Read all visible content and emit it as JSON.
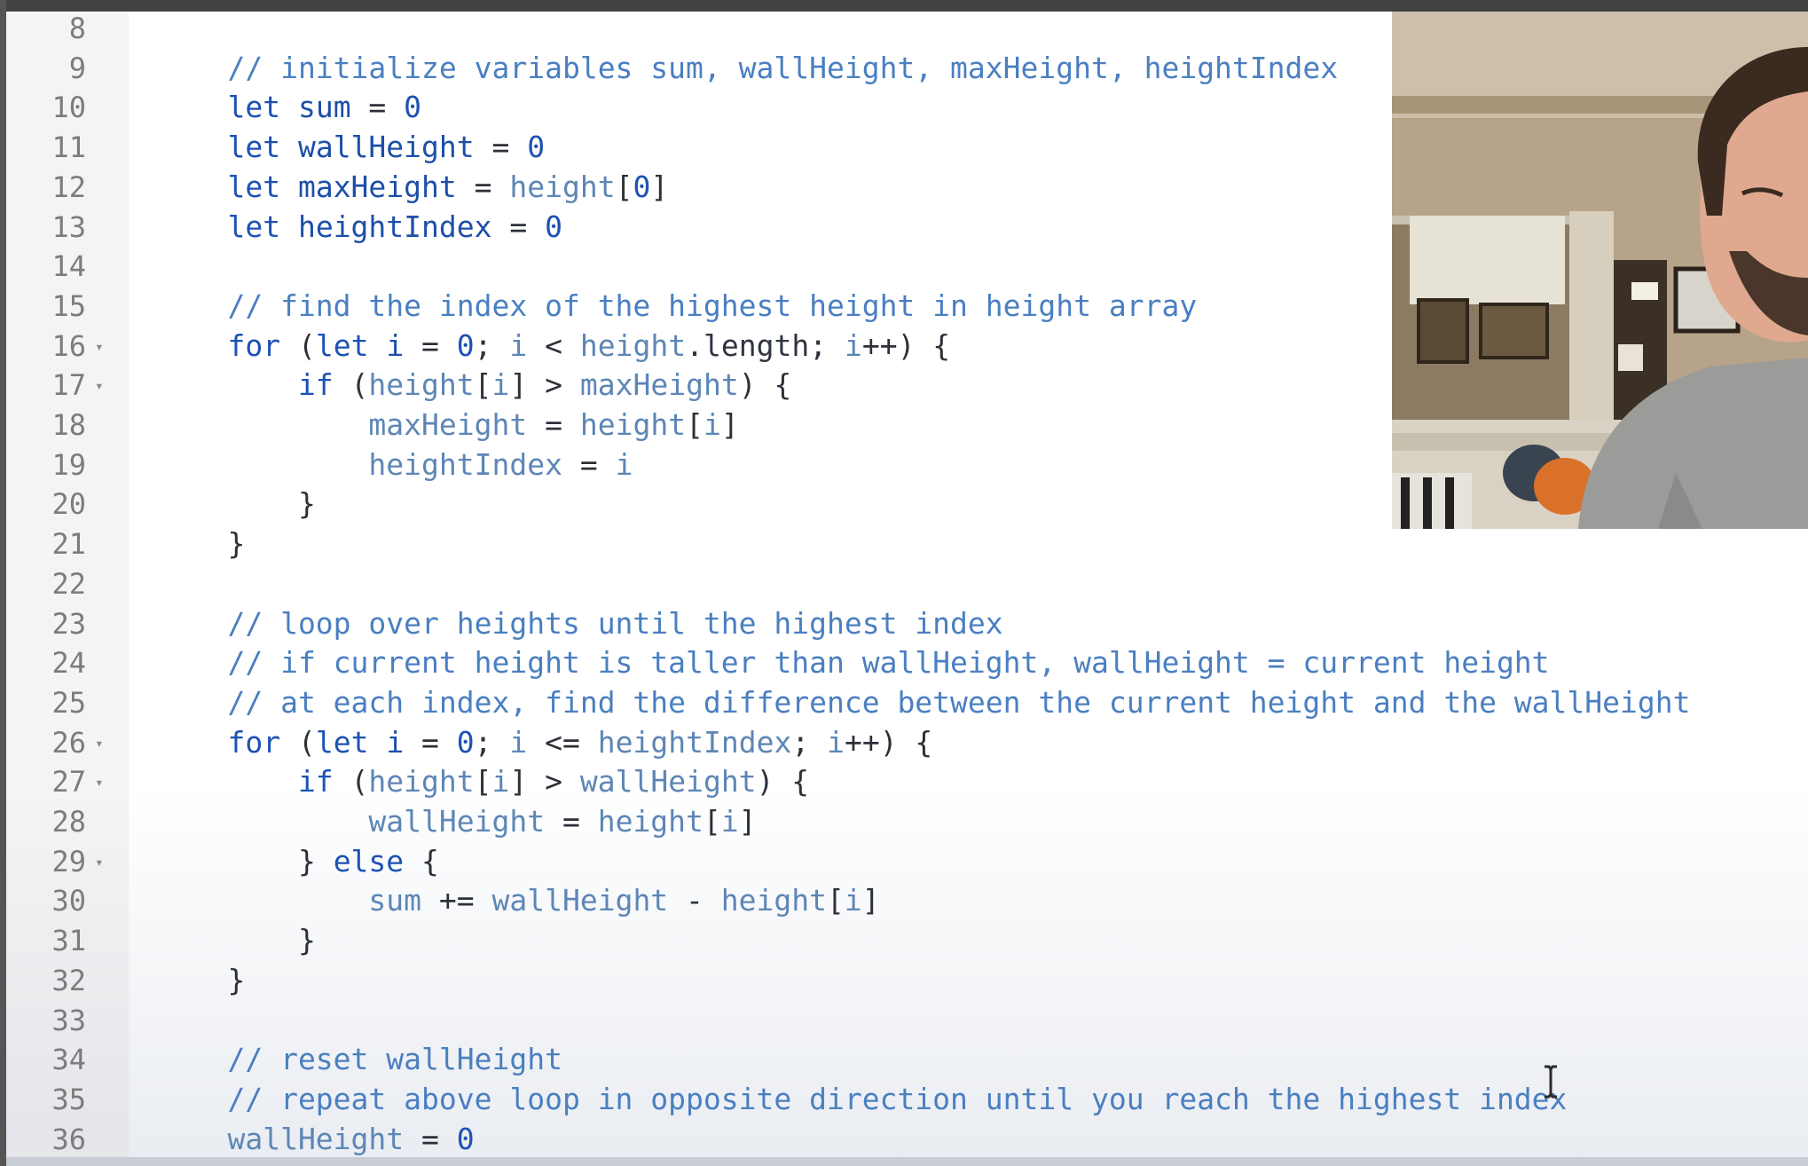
{
  "editor": {
    "lines": [
      {
        "n": "8",
        "fold": false,
        "t": []
      },
      {
        "n": "9",
        "fold": false,
        "t": [
          {
            "c": "cm",
            "s": "    // initialize variables sum, wallHeight, maxHeight, heightIndex"
          }
        ]
      },
      {
        "n": "10",
        "fold": false,
        "t": [
          {
            "c": "kw",
            "s": "    let "
          },
          {
            "c": "id",
            "s": "sum"
          },
          {
            "c": "pu",
            "s": " = "
          },
          {
            "c": "num",
            "s": "0"
          }
        ]
      },
      {
        "n": "11",
        "fold": false,
        "t": [
          {
            "c": "kw",
            "s": "    let "
          },
          {
            "c": "id",
            "s": "wallHeight"
          },
          {
            "c": "pu",
            "s": " = "
          },
          {
            "c": "num",
            "s": "0"
          }
        ]
      },
      {
        "n": "12",
        "fold": false,
        "t": [
          {
            "c": "kw",
            "s": "    let "
          },
          {
            "c": "id",
            "s": "maxHeight"
          },
          {
            "c": "pu",
            "s": " = "
          },
          {
            "c": "var",
            "s": "height"
          },
          {
            "c": "pu",
            "s": "["
          },
          {
            "c": "num",
            "s": "0"
          },
          {
            "c": "pu",
            "s": "]"
          }
        ]
      },
      {
        "n": "13",
        "fold": false,
        "t": [
          {
            "c": "kw",
            "s": "    let "
          },
          {
            "c": "id",
            "s": "heightIndex"
          },
          {
            "c": "pu",
            "s": " = "
          },
          {
            "c": "num",
            "s": "0"
          }
        ]
      },
      {
        "n": "14",
        "fold": false,
        "t": []
      },
      {
        "n": "15",
        "fold": false,
        "t": [
          {
            "c": "cm",
            "s": "    // find the index of the highest height in height array"
          }
        ]
      },
      {
        "n": "16",
        "fold": true,
        "t": [
          {
            "c": "kw",
            "s": "    for "
          },
          {
            "c": "pu",
            "s": "("
          },
          {
            "c": "kw",
            "s": "let "
          },
          {
            "c": "id",
            "s": "i"
          },
          {
            "c": "pu",
            "s": " = "
          },
          {
            "c": "num",
            "s": "0"
          },
          {
            "c": "pu",
            "s": "; "
          },
          {
            "c": "var",
            "s": "i"
          },
          {
            "c": "pu",
            "s": " < "
          },
          {
            "c": "var",
            "s": "height"
          },
          {
            "c": "prop",
            "s": ".length"
          },
          {
            "c": "pu",
            "s": "; "
          },
          {
            "c": "var",
            "s": "i"
          },
          {
            "c": "pu",
            "s": "++) {"
          }
        ]
      },
      {
        "n": "17",
        "fold": true,
        "t": [
          {
            "c": "kw",
            "s": "        if "
          },
          {
            "c": "pu",
            "s": "("
          },
          {
            "c": "var",
            "s": "height"
          },
          {
            "c": "pu",
            "s": "["
          },
          {
            "c": "var",
            "s": "i"
          },
          {
            "c": "pu",
            "s": "] > "
          },
          {
            "c": "var",
            "s": "maxHeight"
          },
          {
            "c": "pu",
            "s": ") {"
          }
        ]
      },
      {
        "n": "18",
        "fold": false,
        "t": [
          {
            "c": "var",
            "s": "            maxHeight"
          },
          {
            "c": "pu",
            "s": " = "
          },
          {
            "c": "var",
            "s": "height"
          },
          {
            "c": "pu",
            "s": "["
          },
          {
            "c": "var",
            "s": "i"
          },
          {
            "c": "pu",
            "s": "]"
          }
        ]
      },
      {
        "n": "19",
        "fold": false,
        "t": [
          {
            "c": "var",
            "s": "            heightIndex"
          },
          {
            "c": "pu",
            "s": " = "
          },
          {
            "c": "var",
            "s": "i"
          }
        ]
      },
      {
        "n": "20",
        "fold": false,
        "t": [
          {
            "c": "pu",
            "s": "        }"
          }
        ]
      },
      {
        "n": "21",
        "fold": false,
        "t": [
          {
            "c": "pu",
            "s": "    }"
          }
        ]
      },
      {
        "n": "22",
        "fold": false,
        "t": []
      },
      {
        "n": "23",
        "fold": false,
        "t": [
          {
            "c": "cm",
            "s": "    // loop over heights until the highest index"
          }
        ]
      },
      {
        "n": "24",
        "fold": false,
        "t": [
          {
            "c": "cm",
            "s": "    // if current height is taller than wallHeight, wallHeight = current height"
          }
        ]
      },
      {
        "n": "25",
        "fold": false,
        "t": [
          {
            "c": "cm",
            "s": "    // at each index, find the difference between the current height and the wallHeight"
          }
        ]
      },
      {
        "n": "26",
        "fold": true,
        "t": [
          {
            "c": "kw",
            "s": "    for "
          },
          {
            "c": "pu",
            "s": "("
          },
          {
            "c": "kw",
            "s": "let "
          },
          {
            "c": "id",
            "s": "i"
          },
          {
            "c": "pu",
            "s": " = "
          },
          {
            "c": "num",
            "s": "0"
          },
          {
            "c": "pu",
            "s": "; "
          },
          {
            "c": "var",
            "s": "i"
          },
          {
            "c": "pu",
            "s": " <= "
          },
          {
            "c": "var",
            "s": "heightIndex"
          },
          {
            "c": "pu",
            "s": "; "
          },
          {
            "c": "var",
            "s": "i"
          },
          {
            "c": "pu",
            "s": "++) {"
          }
        ]
      },
      {
        "n": "27",
        "fold": true,
        "t": [
          {
            "c": "kw",
            "s": "        if "
          },
          {
            "c": "pu",
            "s": "("
          },
          {
            "c": "var",
            "s": "height"
          },
          {
            "c": "pu",
            "s": "["
          },
          {
            "c": "var",
            "s": "i"
          },
          {
            "c": "pu",
            "s": "] > "
          },
          {
            "c": "var",
            "s": "wallHeight"
          },
          {
            "c": "pu",
            "s": ") {"
          }
        ]
      },
      {
        "n": "28",
        "fold": false,
        "t": [
          {
            "c": "var",
            "s": "            wallHeight"
          },
          {
            "c": "pu",
            "s": " = "
          },
          {
            "c": "var",
            "s": "height"
          },
          {
            "c": "pu",
            "s": "["
          },
          {
            "c": "var",
            "s": "i"
          },
          {
            "c": "pu",
            "s": "]"
          }
        ]
      },
      {
        "n": "29",
        "fold": true,
        "t": [
          {
            "c": "pu",
            "s": "        } "
          },
          {
            "c": "kw",
            "s": "else"
          },
          {
            "c": "pu",
            "s": " {"
          }
        ]
      },
      {
        "n": "30",
        "fold": false,
        "t": [
          {
            "c": "var",
            "s": "            sum"
          },
          {
            "c": "pu",
            "s": " += "
          },
          {
            "c": "var",
            "s": "wallHeight"
          },
          {
            "c": "pu",
            "s": " - "
          },
          {
            "c": "var",
            "s": "height"
          },
          {
            "c": "pu",
            "s": "["
          },
          {
            "c": "var",
            "s": "i"
          },
          {
            "c": "pu",
            "s": "]"
          }
        ]
      },
      {
        "n": "31",
        "fold": false,
        "t": [
          {
            "c": "pu",
            "s": "        }"
          }
        ]
      },
      {
        "n": "32",
        "fold": false,
        "t": [
          {
            "c": "pu",
            "s": "    }"
          }
        ]
      },
      {
        "n": "33",
        "fold": false,
        "t": []
      },
      {
        "n": "34",
        "fold": false,
        "t": [
          {
            "c": "cm",
            "s": "    // reset wallHeight"
          }
        ]
      },
      {
        "n": "35",
        "fold": false,
        "t": [
          {
            "c": "cm",
            "s": "    // repeat above loop in opposite direction until you reach the highest index"
          }
        ]
      },
      {
        "n": "36",
        "fold": false,
        "t": [
          {
            "c": "var",
            "s": "    wallHeight"
          },
          {
            "c": "pu",
            "s": " = "
          },
          {
            "c": "num",
            "s": "0"
          }
        ]
      }
    ],
    "fold_glyph": "▾",
    "cursor_icon": "text-cursor-icon"
  },
  "webcam": {
    "label": "presenter-webcam",
    "colors": {
      "wall": "#b7a38a",
      "ceiling": "#c9bba6",
      "sofa": "#d9d2c4",
      "hoodie": "#9b9b99",
      "skin": "#e0a98f",
      "hair": "#3a2a20"
    }
  }
}
